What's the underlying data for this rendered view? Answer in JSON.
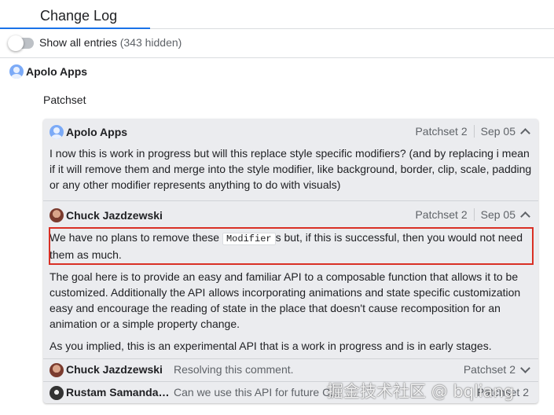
{
  "tab": {
    "label": "Change Log"
  },
  "toggle": {
    "label": "Show all entries",
    "count": "(343 hidden)"
  },
  "top_author": {
    "name": "Apolo Apps",
    "avatar": "person-avatar"
  },
  "patchset_heading": "Patchset",
  "thread": {
    "messages": [
      {
        "author": "Apolo Apps",
        "avatar": "person-avatar",
        "patchset": "Patchset 2",
        "date": "Sep 05",
        "body": "I now this is work in progress but will this replace style specific modifiers? (and by replacing i mean if it will remove them and merge into the style modifier, like background, border, clip, scale, padding or any other modifier represents anything to do with visuals)"
      },
      {
        "author": "Chuck Jazdzewski",
        "avatar": "photo-avatar",
        "patchset": "Patchset 2",
        "date": "Sep 05",
        "highlight_pre": "We have no plans to remove these ",
        "highlight_code": "Modifier",
        "highlight_post": "s but, if this is successful, then you would not need them as much.",
        "para2": "The goal here is to provide an easy and familiar API to a composable function that allows it to be customized. Additionally the API allows incorporating animations and state specific customization easy and encourage the reading of state in the place that doesn't cause recomposition for an animation or a simple property change.",
        "para3": "As you implied, this is an experimental API that is a work in progress and is in early stages."
      }
    ],
    "collapsed": [
      {
        "author": "Chuck Jazdzewski",
        "snippet": "Resolving this comment.",
        "patchset": "Patchset 2"
      },
      {
        "author": "Rustam Samandar...",
        "snippet": "Can we use this API for future C...",
        "patchset": "Patchset 2"
      }
    ]
  },
  "watermark": "掘金技术社区 @ bqliang",
  "colors": {
    "accent": "#1a73e8",
    "highlight_border": "#d93025",
    "thread_bg": "#ebecef"
  }
}
